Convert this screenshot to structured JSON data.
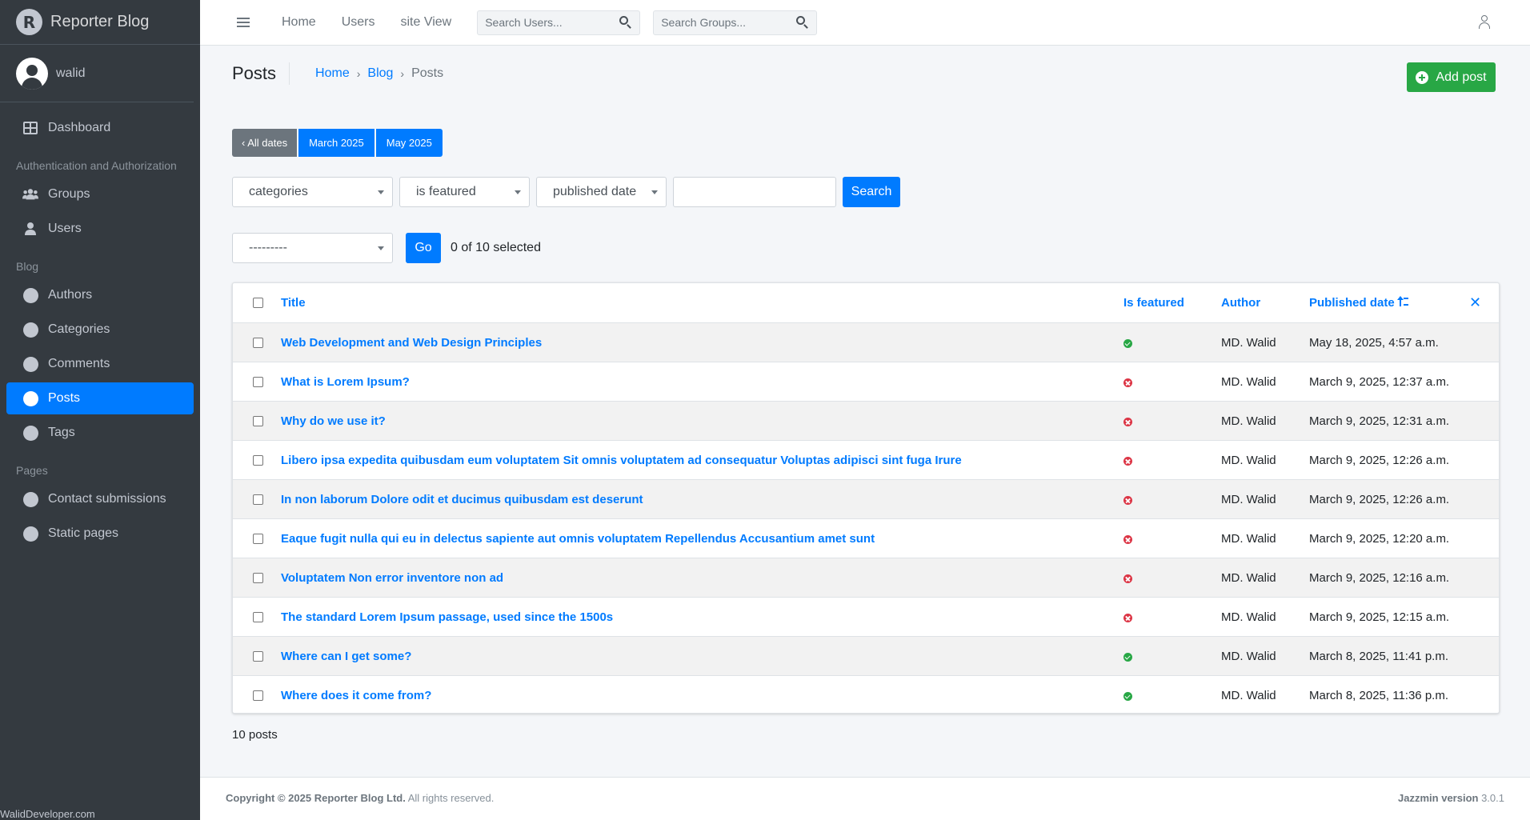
{
  "brand": {
    "name": "Reporter Blog",
    "logo_letter": "R"
  },
  "user": {
    "name": "walid"
  },
  "sidebar": {
    "dashboard": "Dashboard",
    "sections": [
      {
        "header": "Authentication and Authorization",
        "items": [
          "Groups",
          "Users"
        ]
      },
      {
        "header": "Blog",
        "items": [
          "Authors",
          "Categories",
          "Comments",
          "Posts",
          "Tags"
        ]
      },
      {
        "header": "Pages",
        "items": [
          "Contact submissions",
          "Static pages"
        ]
      }
    ],
    "active": "Posts",
    "credit": "WalidDeveloper.com"
  },
  "topbar": {
    "links": [
      "Home",
      "Users",
      "site View"
    ],
    "search_users_placeholder": "Search Users...",
    "search_groups_placeholder": "Search Groups..."
  },
  "header": {
    "title": "Posts",
    "breadcrumb": [
      "Home",
      "Blog",
      "Posts"
    ],
    "add_button": "Add post"
  },
  "date_filters": [
    "‹ All dates",
    "March 2025",
    "May 2025"
  ],
  "filters": {
    "categories": "categories",
    "is_featured": "is featured",
    "published_date": "published date",
    "search_button": "Search"
  },
  "actions": {
    "select_value": "---------",
    "go_button": "Go",
    "selected_text": "0 of 10 selected"
  },
  "table": {
    "columns": {
      "title": "Title",
      "is_featured": "Is featured",
      "author": "Author",
      "published_date": "Published date"
    },
    "rows": [
      {
        "title": "Web Development and Web Design Principles",
        "featured": true,
        "author": "MD. Walid",
        "date": "May 18, 2025, 4:57 a.m."
      },
      {
        "title": "What is Lorem Ipsum?",
        "featured": false,
        "author": "MD. Walid",
        "date": "March 9, 2025, 12:37 a.m."
      },
      {
        "title": "Why do we use it?",
        "featured": false,
        "author": "MD. Walid",
        "date": "March 9, 2025, 12:31 a.m."
      },
      {
        "title": "Libero ipsa expedita quibusdam eum voluptatem Sit omnis voluptatem ad consequatur Voluptas adipisci sint fuga Irure",
        "featured": false,
        "author": "MD. Walid",
        "date": "March 9, 2025, 12:26 a.m."
      },
      {
        "title": "In non laborum Dolore odit et ducimus quibusdam est deserunt",
        "featured": false,
        "author": "MD. Walid",
        "date": "March 9, 2025, 12:26 a.m."
      },
      {
        "title": "Eaque fugit nulla qui eu in delectus sapiente aut omnis voluptatem Repellendus Accusantium amet sunt",
        "featured": false,
        "author": "MD. Walid",
        "date": "March 9, 2025, 12:20 a.m."
      },
      {
        "title": "Voluptatem Non error inventore non ad",
        "featured": false,
        "author": "MD. Walid",
        "date": "March 9, 2025, 12:16 a.m."
      },
      {
        "title": "The standard Lorem Ipsum passage, used since the 1500s",
        "featured": false,
        "author": "MD. Walid",
        "date": "March 9, 2025, 12:15 a.m."
      },
      {
        "title": "Where can I get some?",
        "featured": true,
        "author": "MD. Walid",
        "date": "March 8, 2025, 11:41 p.m."
      },
      {
        "title": "Where does it come from?",
        "featured": true,
        "author": "MD. Walid",
        "date": "March 8, 2025, 11:36 p.m."
      }
    ]
  },
  "post_count": "10 posts",
  "footer": {
    "copyright_bold": "Copyright © 2025 Reporter Blog Ltd.",
    "copyright_rest": " All rights reserved.",
    "version_bold": "Jazzmin version",
    "version_num": " 3.0.1"
  },
  "colors": {
    "primary": "#007bff",
    "success": "#28a745",
    "danger": "#dc3545",
    "sidebar": "#343a40"
  }
}
